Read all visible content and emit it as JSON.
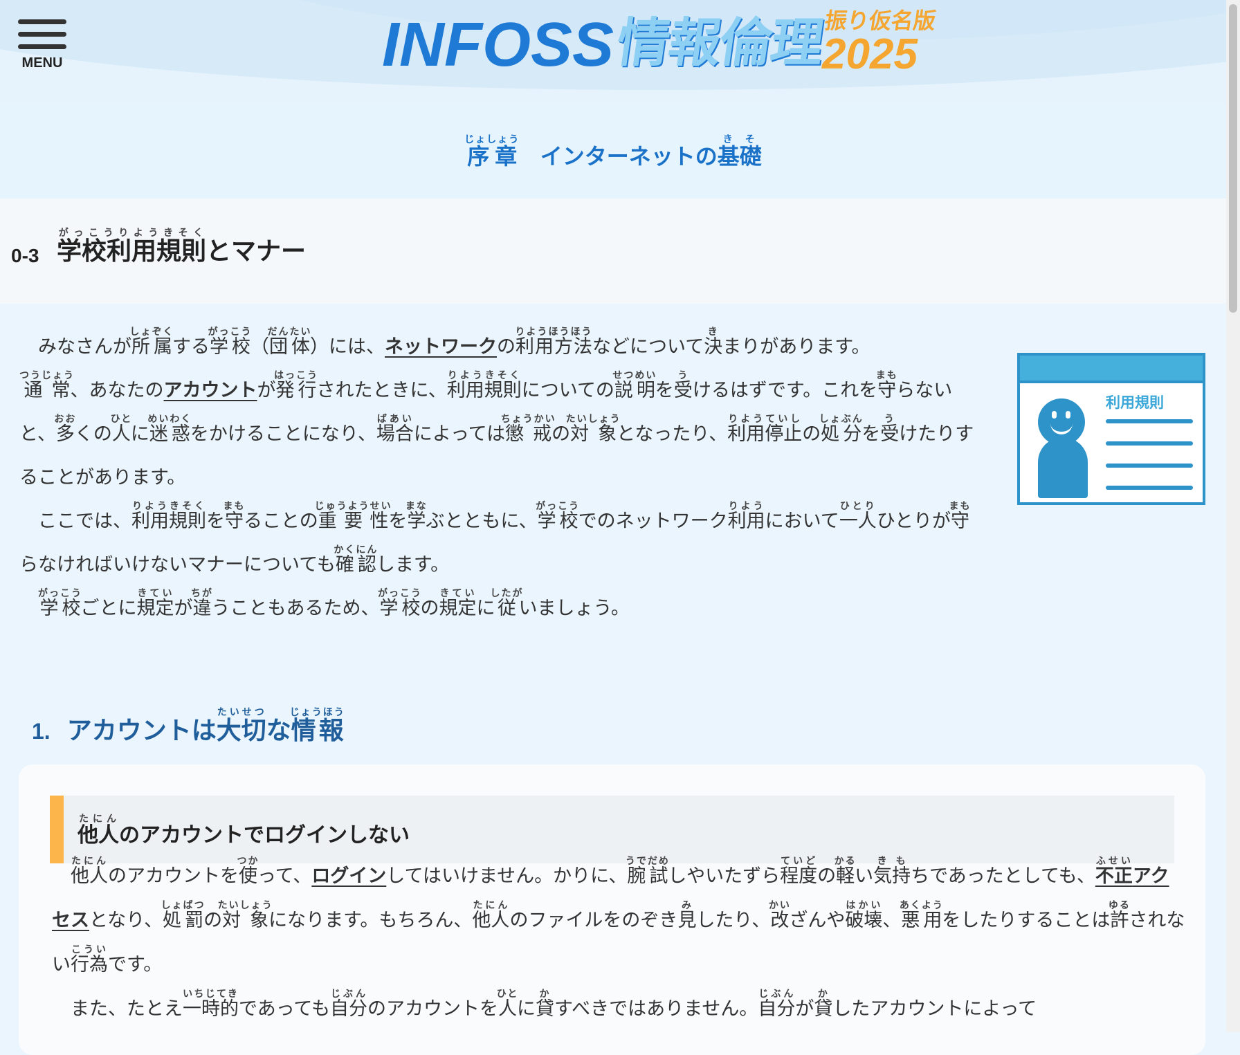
{
  "menu": {
    "label": "MENU"
  },
  "logo": {
    "latin": "INFOSS",
    "jp": "情報倫理",
    "furigana_label": "振り仮名版",
    "year": "2025"
  },
  "chapter": {
    "label": "序章",
    "label_ruby": "じょしょう",
    "title1": "インターネットの",
    "title2": "基礎",
    "title2_ruby": "きそ"
  },
  "section": {
    "number": "0-3",
    "title": "学校利用規則",
    "title_ruby": "がっこうりようきそく",
    "title_rest": "とマナー"
  },
  "intro": {
    "p1": "みなさんが所属する学校（団体）には、ネットワークの利用方法などについて決まりがあります。",
    "p2": "通常、あなたのアカウントが発行されたときに、利用規則についての説明を受けるはずです。これを守らないと、多くの人に迷惑をかけることになり、場合によっては懲戒の対象となったり、利用停止の処分を受けたりすることがあります。",
    "p3": "ここでは、利用規則を守ることの重要性を学ぶとともに、学校でのネットワーク利用において一人ひとりが守らなければいけないマナーについても確認します。",
    "p4": "学校ごとに規定が違うこともあるため、学校の規定に従いましょう。"
  },
  "illustration": {
    "title": "利用規則",
    "icon": "rules-card-illustration"
  },
  "subsection": {
    "number": "1.",
    "title": "アカウントは大切な情報"
  },
  "card": {
    "box_title": "他人のアカウントでログインしない",
    "p1": "他人のアカウントを使って、ログインしてはいけません。かりに、腕試しやいたずら程度の軽い気持ちであったとしても、不正アクセスとなり、処罰の対象になります。もちろん、他人のファイルをのぞき見したり、改ざんや破壊、悪用をしたりすることは許されない行為です。",
    "p2": "また、たとえ一時的であっても自分のアカウントを人に貸すべきではありません。自分が貸したアカウントによって"
  },
  "colors": {
    "accent": "#1f7ad6",
    "heading": "#1f5e9b",
    "highlight_bar": "#fbb54a",
    "orange": "#f5a630"
  }
}
